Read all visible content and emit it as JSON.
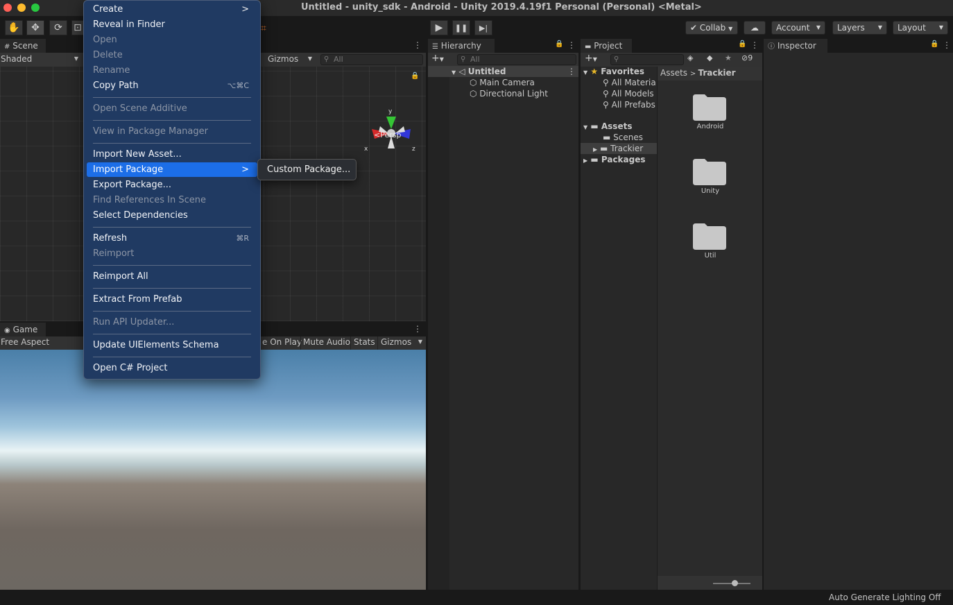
{
  "window": {
    "title": "Untitled - unity_sdk - Android - Unity 2019.4.19f1 Personal (Personal) <Metal>"
  },
  "toolbar": {
    "collab_label": "Collab",
    "account_label": "Account",
    "layers_label": "Layers",
    "layout_label": "Layout"
  },
  "scene": {
    "tab_label": "Scene",
    "shading_mode": "Shaded",
    "gizmos_label": "Gizmos",
    "search_placeholder": "All",
    "persp_label": "Persp",
    "axis_x": "x",
    "axis_y": "y",
    "axis_z": "z"
  },
  "game": {
    "tab_label": "Game",
    "aspect": "Free Aspect",
    "maximize_label": "e On Play",
    "mute_label": "Mute Audio",
    "stats_label": "Stats",
    "gizmos_label": "Gizmos"
  },
  "hierarchy": {
    "tab_label": "Hierarchy",
    "search_placeholder": "All",
    "scene_name": "Untitled",
    "items": [
      {
        "label": "Main Camera"
      },
      {
        "label": "Directional Light"
      }
    ]
  },
  "project": {
    "tab_label": "Project",
    "hidden_count": "9",
    "favorites_label": "Favorites",
    "favorites": [
      {
        "label": "All Materia"
      },
      {
        "label": "All Models"
      },
      {
        "label": "All Prefabs"
      }
    ],
    "assets_label": "Assets",
    "asset_folders": [
      {
        "label": "Scenes"
      },
      {
        "label": "Trackier"
      }
    ],
    "packages_label": "Packages",
    "breadcrumb": [
      "Assets",
      "Trackier"
    ],
    "grid_items": [
      {
        "label": "Android"
      },
      {
        "label": "Unity"
      },
      {
        "label": "Util"
      }
    ]
  },
  "inspector": {
    "tab_label": "Inspector"
  },
  "context_menu": {
    "items": [
      {
        "label": "Create",
        "shortcut": "",
        "enabled": true
      },
      {
        "label": "Reveal in Finder",
        "shortcut": "",
        "enabled": true
      },
      {
        "label": "Open",
        "shortcut": "",
        "enabled": false
      },
      {
        "label": "Delete",
        "shortcut": "",
        "enabled": false
      },
      {
        "label": "Rename",
        "shortcut": "",
        "enabled": false
      },
      {
        "label": "Copy Path",
        "shortcut": "⌥⌘C",
        "enabled": true
      },
      {
        "label": "Open Scene Additive",
        "shortcut": "",
        "enabled": false
      },
      {
        "label": "View in Package Manager",
        "shortcut": "",
        "enabled": false
      },
      {
        "label": "Import New Asset...",
        "shortcut": "",
        "enabled": true
      },
      {
        "label": "Import Package",
        "shortcut": "",
        "enabled": true,
        "selected": true
      },
      {
        "label": "Export Package...",
        "shortcut": "",
        "enabled": true
      },
      {
        "label": "Find References In Scene",
        "shortcut": "",
        "enabled": false
      },
      {
        "label": "Select Dependencies",
        "shortcut": "",
        "enabled": true
      },
      {
        "label": "Refresh",
        "shortcut": "⌘R",
        "enabled": true
      },
      {
        "label": "Reimport",
        "shortcut": "",
        "enabled": false
      },
      {
        "label": "Reimport All",
        "shortcut": "",
        "enabled": true
      },
      {
        "label": "Extract From Prefab",
        "shortcut": "",
        "enabled": true
      },
      {
        "label": "Run API Updater...",
        "shortcut": "",
        "enabled": false
      },
      {
        "label": "Update UIElements Schema",
        "shortcut": "",
        "enabled": true
      },
      {
        "label": "Open C# Project",
        "shortcut": "",
        "enabled": true
      }
    ],
    "submenu_item": "Custom Package..."
  },
  "status_bar": {
    "text": "Auto Generate Lighting Off"
  },
  "colors": {
    "menu_bg": "#203a62",
    "menu_selected": "#1c6ee8",
    "panel_bg": "#282828",
    "tab_strip": "#191919",
    "selection_row": "#3e3e3e",
    "folder_fill": "#c8c8c8",
    "close_light": "#fe5f57",
    "minimize_light": "#febc2e",
    "maximize_light": "#28c840"
  }
}
